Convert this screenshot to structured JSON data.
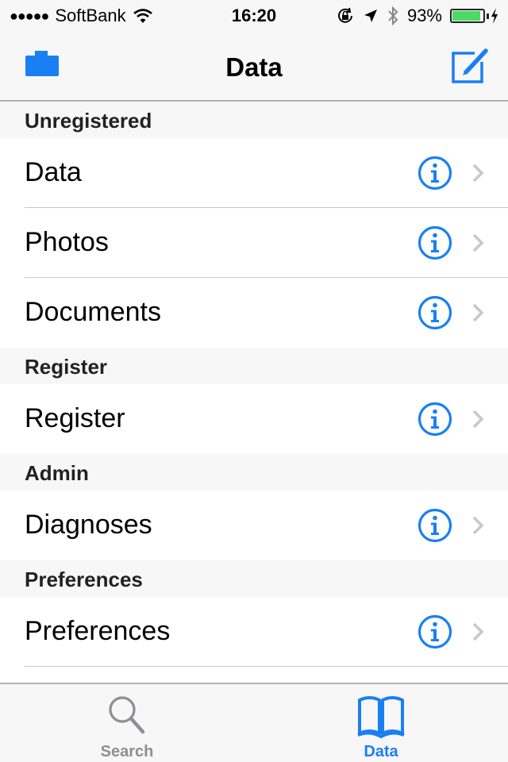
{
  "status_bar": {
    "signal_dots": "●●●●●",
    "carrier": "SoftBank",
    "time": "16:20",
    "battery_percent": "93%",
    "battery_level": 0.93,
    "battery_color": "#4cd964"
  },
  "nav": {
    "title": "Data",
    "left_icon": "briefcase-icon",
    "right_icon": "compose-icon",
    "accent": "#1a7ff2"
  },
  "sections": [
    {
      "header": "Unregistered",
      "rows": [
        {
          "label": "Data"
        },
        {
          "label": "Photos"
        },
        {
          "label": "Documents"
        }
      ]
    },
    {
      "header": "Register",
      "rows": [
        {
          "label": "Register"
        }
      ]
    },
    {
      "header": "Admin",
      "rows": [
        {
          "label": "Diagnoses"
        }
      ]
    },
    {
      "header": "Preferences",
      "rows": [
        {
          "label": "Preferences"
        }
      ]
    }
  ],
  "tab_bar": {
    "tabs": [
      {
        "label": "Search",
        "icon": "search-icon",
        "active": false,
        "color": "#8e8e93"
      },
      {
        "label": "Data",
        "icon": "book-icon",
        "active": true,
        "color": "#1a7ff2"
      }
    ]
  }
}
